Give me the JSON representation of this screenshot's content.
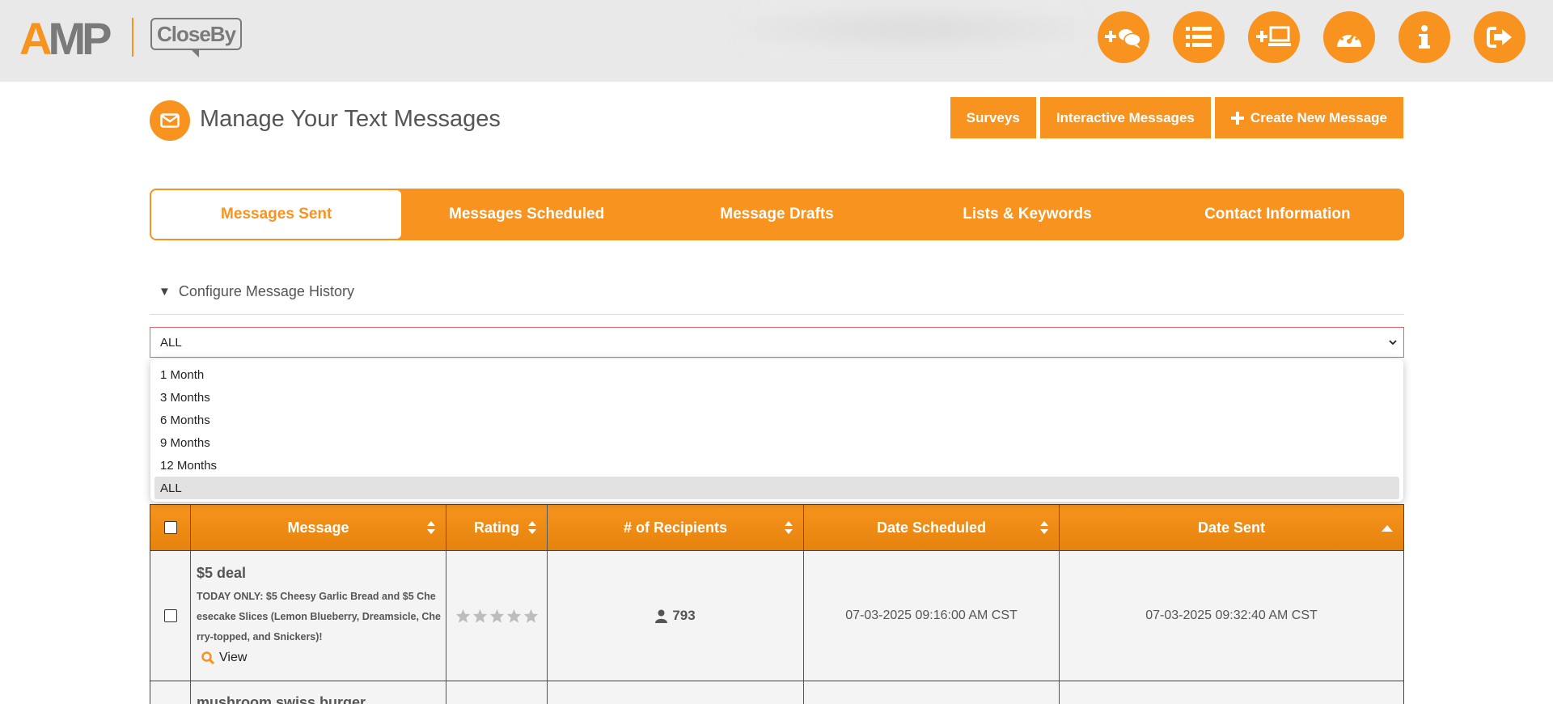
{
  "logo": {
    "amp_a": "A",
    "amp_mp": "MP",
    "closeby": "CloseBy"
  },
  "nav_icons": [
    "add-chat-icon",
    "list-icon",
    "add-laptop-icon",
    "dashboard-gauge-icon",
    "info-icon",
    "logout-icon"
  ],
  "header": {
    "title": "Manage Your Text Messages",
    "buttons": {
      "surveys": "Surveys",
      "interactive": "Interactive Messages",
      "create": "Create New Message"
    }
  },
  "tabs": [
    {
      "label": "Messages Sent",
      "active": true
    },
    {
      "label": "Messages Scheduled",
      "active": false
    },
    {
      "label": "Message Drafts",
      "active": false
    },
    {
      "label": "Lists & Keywords",
      "active": false
    },
    {
      "label": "Contact Information",
      "active": false
    }
  ],
  "configure": {
    "label": "Configure Message History"
  },
  "history_select": {
    "value": "ALL",
    "options": [
      "1 Month",
      "3 Months",
      "6 Months",
      "9 Months",
      "12 Months",
      "ALL"
    ]
  },
  "table": {
    "headers": {
      "message": "Message",
      "rating": "Rating",
      "recipients": "# of Recipients",
      "date_scheduled": "Date Scheduled",
      "date_sent": "Date Sent"
    },
    "rows": [
      {
        "title": "$5 deal",
        "body": "TODAY ONLY: $5 Cheesy Garlic Bread and $5 Cheesecake Slices (Lemon Blueberry, Dreamsicle, Cherry-topped, and Snickers)!",
        "view_label": "View",
        "rating": 0,
        "recipients": "793",
        "date_scheduled": "07-03-2025 09:16:00 AM CST",
        "date_sent": "07-03-2025 09:32:40 AM CST"
      },
      {
        "title": "mushroom swiss burger"
      }
    ]
  },
  "colors": {
    "accent": "#f7931e",
    "header_bg": "#e9e9e9",
    "select_border": "#e06666"
  }
}
